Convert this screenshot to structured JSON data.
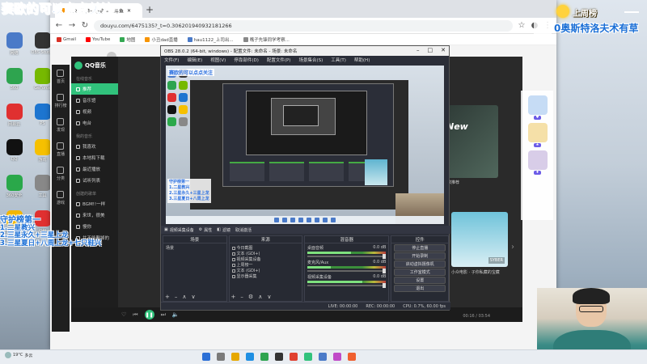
{
  "overlay": {
    "title": "赛欧的可以点点关注",
    "side_lines": [
      "守护榜第一",
      "1.二星教兴",
      "2.三星永久+三星上龙",
      "3.三星夏日+八周上龙+七只鞋兴"
    ],
    "rank_label": "上周榜",
    "scroll_text": "0奥斯特洛夫术有草"
  },
  "desktop": {
    "icons": [
      {
        "label": "网络",
        "color": "#4a7ac8"
      },
      {
        "label": "OBS Studio",
        "color": "#333333"
      },
      {
        "label": "360",
        "color": "#2ea44f"
      },
      {
        "label": "GeForce",
        "color": "#76b900"
      },
      {
        "label": "网易云",
        "color": "#e03030"
      },
      {
        "label": "PS",
        "color": "#1d75d0"
      },
      {
        "label": "QQ",
        "color": "#111111"
      },
      {
        "label": "游戏",
        "color": "#f6c000"
      },
      {
        "label": "360安全",
        "color": "#2aa84a"
      },
      {
        "label": "工具",
        "color": "#888888"
      },
      {
        "label": "WeChat",
        "color": "#f2b600"
      },
      {
        "label": "红包",
        "color": "#e03030"
      }
    ]
  },
  "browser": {
    "tab_title": "2024的第一场直播...斗鱼",
    "url": "douyu.com/6475135?_t=0.306201940932181266",
    "bookmarks": [
      "Gmail",
      "YouTube",
      "地图",
      "小丑dad直播",
      "hau1122_上司出...",
      "嘴子先锋同学考察..."
    ],
    "douyu_nav": [
      "首页",
      "排行榜",
      "发现",
      "直播",
      "分类",
      "游戏"
    ]
  },
  "qqmusic": {
    "logo": "QQ音乐",
    "sections": [
      "在线音乐",
      "我的音乐"
    ],
    "nav_items": [
      "推荐",
      "音乐馆",
      "视频",
      "电台"
    ],
    "my_items": [
      "我喜欢",
      "本地和下载",
      "最近播放",
      "试听列表"
    ],
    "playlists_header": "创建的歌单",
    "playlists": [
      "BGM!!一样",
      "来世，很美",
      "慢你",
      "并不能删掉的"
    ],
    "card1_new": "New",
    "card1_label": "新歌推荐",
    "card2_tag": "SYBER",
    "card2_label": "小众电影 · 子你私藏的宝藏",
    "play_time": "00:16 / 03:54"
  },
  "obs": {
    "title": "OBS 28.0.2 (64-bit, windows) - 配置文件: 未命名 - 场景: 未命名",
    "menu": [
      "文件(F)",
      "编辑(E)",
      "视图(V)",
      "停靠部件(D)",
      "配置文件(P)",
      "场景集合(S)",
      "工具(T)",
      "帮助(H)"
    ],
    "preview_text": "赛欧的可以点点关注",
    "preview_lines": [
      "守护榜第一",
      "1.二星教兴",
      "2.三星永久+三星上龙",
      "3.三星夏日+八周上龙"
    ],
    "source_bar": [
      "视频采集设备",
      "属性",
      "滤镜",
      "取消激活"
    ],
    "dock_scenes_title": "场景",
    "scene_item": "场景",
    "dock_sources_title": "来源",
    "sources": [
      "今日截图",
      "文本 (GDI+)",
      "视频采集设备",
      "上周榜一",
      "文本 (GDI+)",
      "显示器采集"
    ],
    "dock_mixer_title": "混音器",
    "mixer": [
      {
        "name": "桌面音频",
        "db": "0.0 dB",
        "level": 0.55
      },
      {
        "name": "麦克风/Aux",
        "db": "0.0 dB",
        "level": 0.3
      },
      {
        "name": "视频采集设备",
        "db": "0.0 dB",
        "level": 0.7
      }
    ],
    "dock_controls_title": "控件",
    "controls": [
      "停止直播",
      "开始录制",
      "启动虚拟摄像机",
      "工作室模式",
      "设置",
      "退出"
    ],
    "status": [
      "LIVE: 00:00:00",
      "REC: 00:00:00",
      "CPU: 0.7%, 60.00 fps"
    ]
  },
  "weather": {
    "temp": "19°C",
    "desc": "多云"
  }
}
